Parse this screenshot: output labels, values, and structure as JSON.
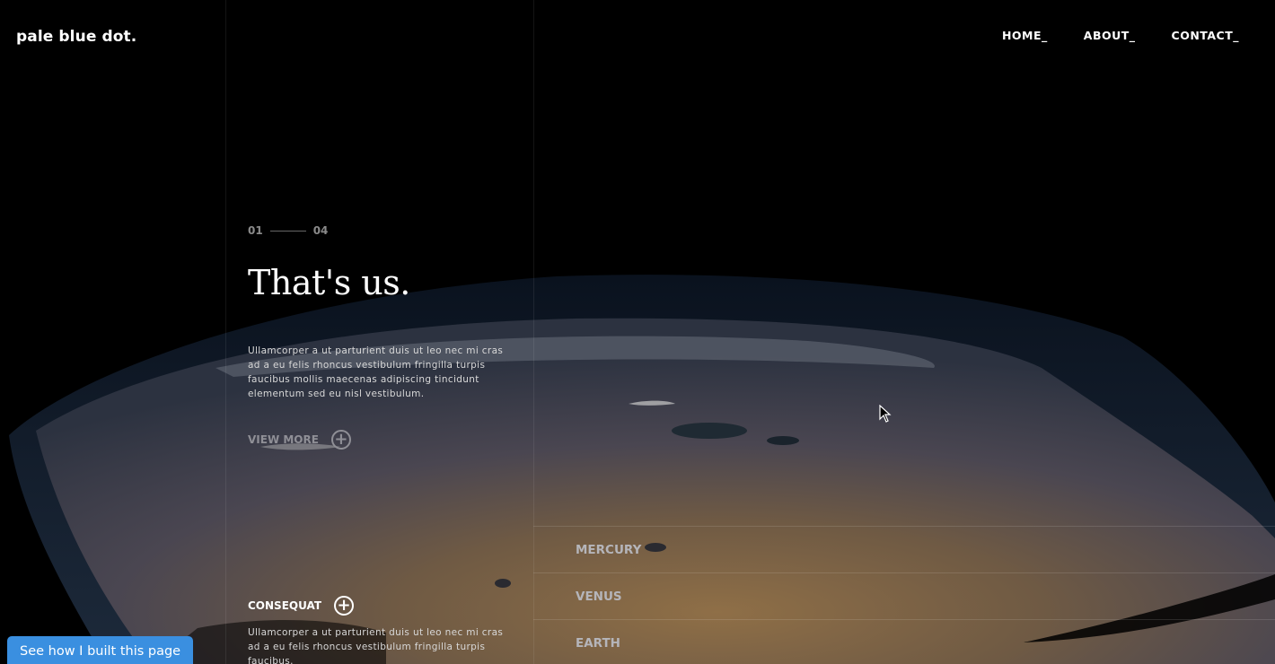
{
  "brand": {
    "logo": "pale blue dot."
  },
  "nav": {
    "items": [
      "HOME_",
      "ABOUT_",
      "CONTACT_"
    ]
  },
  "hero": {
    "counter_current": "01",
    "counter_total": "04",
    "title": "That's us.",
    "body": "Ullamcorper a ut parturient duis ut leo nec mi cras ad a eu felis rhoncus vestibulum fringilla turpis faucibus mollis maecenas adipiscing tincidunt elementum sed eu nisl vestibulum.",
    "view_more": "VIEW MORE"
  },
  "secondary": {
    "label": "CONSEQUAT",
    "body": "Ullamcorper a ut parturient duis ut leo nec mi cras ad a eu felis rhoncus vestibulum fringilla turpis faucibus."
  },
  "planets": {
    "items": [
      "MERCURY",
      "VENUS",
      "EARTH"
    ]
  },
  "footer_button": {
    "label": "See how I built this page"
  },
  "colors": {
    "background": "#000000",
    "accent_button": "#3a8fe0",
    "muted_text": "#8a8a8a"
  },
  "icons": {
    "plus": "plus-circle-icon",
    "cursor": "mouse-pointer-icon"
  }
}
